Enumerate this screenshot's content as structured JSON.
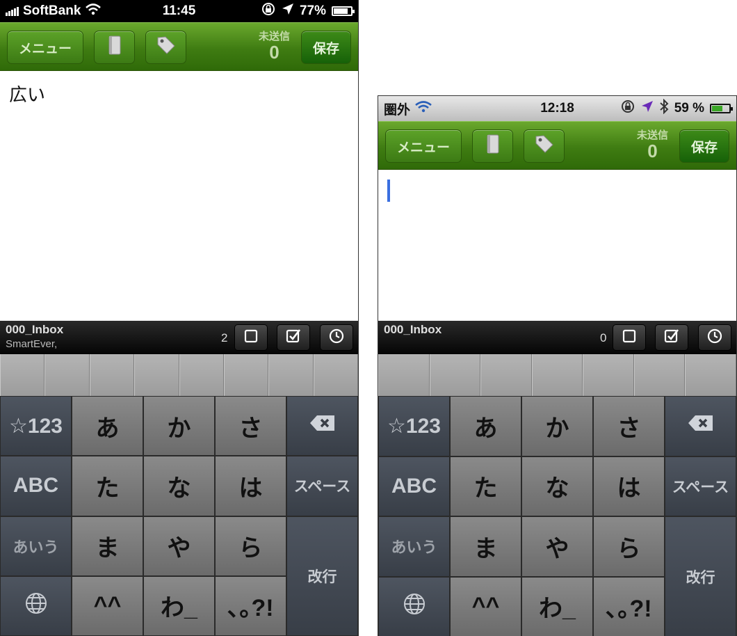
{
  "left": {
    "status": {
      "carrier": "SoftBank",
      "time": "11:45",
      "battery": "77%"
    },
    "toolbar": {
      "menu": "メニュー",
      "unsent_label": "未送信",
      "unsent_count": "0",
      "save": "保存"
    },
    "editor_text": "広い",
    "info": {
      "notebook": "000_Inbox",
      "tags": "SmartEver,",
      "count": "2"
    }
  },
  "right": {
    "status": {
      "carrier": "圏外",
      "time": "12:18",
      "battery": "59 %"
    },
    "toolbar": {
      "menu": "メニュー",
      "unsent_label": "未送信",
      "unsent_count": "0",
      "save": "保存"
    },
    "info": {
      "notebook": "000_Inbox",
      "count": "0"
    }
  },
  "keyboard": {
    "num": "☆123",
    "abc": "ABC",
    "aiu": "あいう",
    "a": "あ",
    "ka": "か",
    "sa": "さ",
    "ta": "た",
    "na": "な",
    "ha": "は",
    "ma": "ま",
    "ya": "や",
    "ra": "ら",
    "dakuten": "^^",
    "wa": "わ_",
    "punct": "､｡?!",
    "space": "スペース",
    "enter": "改行"
  },
  "colors": {
    "toolbar_green": "#3f7c12",
    "caret": "#3a6fe0"
  }
}
